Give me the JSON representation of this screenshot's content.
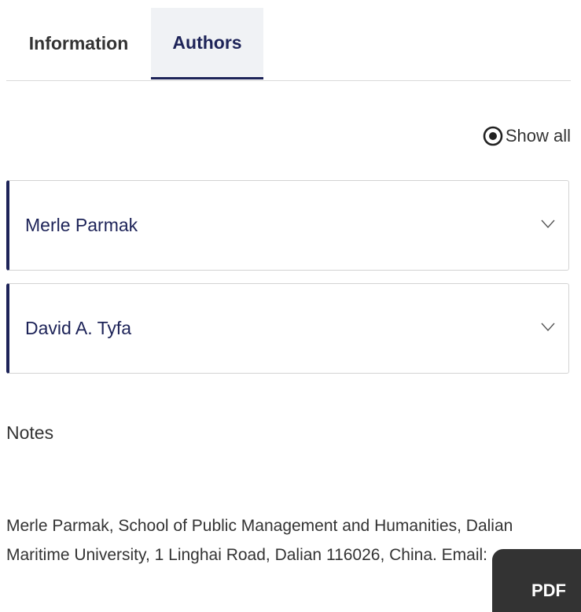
{
  "tabs": [
    {
      "label": "Information",
      "active": false
    },
    {
      "label": "Authors",
      "active": true
    }
  ],
  "show_all": {
    "label": "Show all",
    "icon": "eye-icon"
  },
  "authors": [
    {
      "name": "Merle Parmak"
    },
    {
      "name": "David A. Tyfa"
    }
  ],
  "notes": {
    "heading": "Notes",
    "lines": [
      "Merle Parmak, School of Public Management and Humanities, Dalian",
      "Maritime University, 1 Linghai Road, Dalian 116026, China. Email:"
    ]
  },
  "pdf_button": {
    "label": "PDF"
  },
  "colors": {
    "accent": "#1d2358",
    "text": "#333333",
    "border": "#d3d3d3",
    "active_tab_bg": "#f0f2f5"
  }
}
